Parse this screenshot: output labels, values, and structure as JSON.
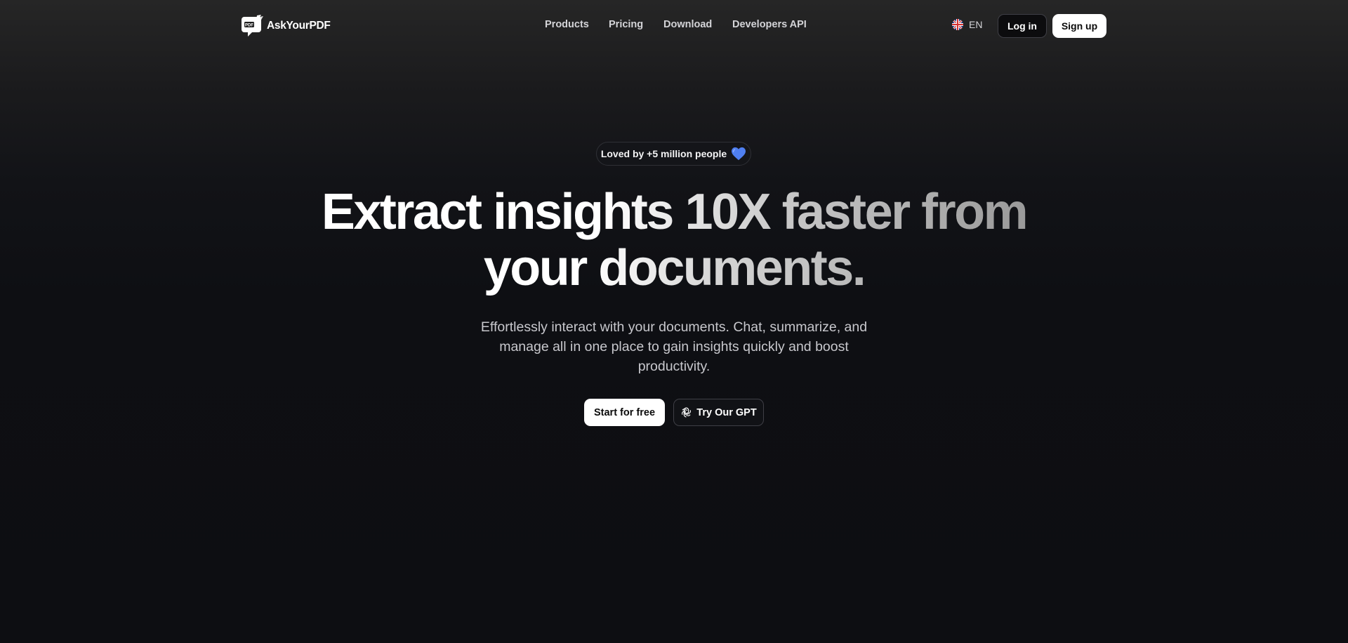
{
  "brand": {
    "name": "AskYourPDF",
    "logo_badge": "PDF"
  },
  "nav": {
    "items": [
      {
        "label": "Products"
      },
      {
        "label": "Pricing"
      },
      {
        "label": "Download"
      },
      {
        "label": "Developers API"
      }
    ]
  },
  "header": {
    "language": "EN",
    "login_label": "Log in",
    "signup_label": "Sign up"
  },
  "hero": {
    "badge": "Loved by +5 million people",
    "headline_line1": "Extract insights 10X faster from",
    "headline_line2": "your documents.",
    "subtitle": "Effortlessly interact with your documents. Chat, summarize, and manage all in one place to gain insights quickly and boost productivity.",
    "primary_cta": "Start for free",
    "secondary_cta": "Try Our GPT"
  },
  "icons": {
    "heart": "blue-heart-icon",
    "flag": "uk-flag-icon",
    "gpt": "openai-icon"
  },
  "colors": {
    "background": "#0d0e12",
    "heart": "#4f7ff0",
    "primary_button": "#ffffff"
  }
}
